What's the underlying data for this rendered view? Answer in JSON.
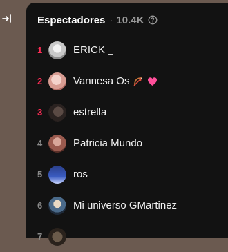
{
  "panel": {
    "title": "Espectadores",
    "separator": "·",
    "count": "10.4K"
  },
  "viewers": [
    {
      "rank": "1",
      "name": "ERICK",
      "top": true
    },
    {
      "rank": "2",
      "name": "Vannesa Os",
      "top": true
    },
    {
      "rank": "3",
      "name": "estrella",
      "top": true
    },
    {
      "rank": "4",
      "name": "Patricia Mundo",
      "top": false
    },
    {
      "rank": "5",
      "name": "ros",
      "top": false
    },
    {
      "rank": "6",
      "name": "Mi universo GMartinez",
      "top": false
    },
    {
      "rank": "7",
      "name": "",
      "top": false
    }
  ],
  "colors": {
    "top_rank": "#fe2c55",
    "panel_bg": "#121212",
    "page_bg": "#6b5a50"
  },
  "icons": {
    "collapse": "arrow-right-to-line-icon",
    "help": "question-circle-icon",
    "bow": "bow-and-arrow-emoji",
    "heart": "pink-heart-emoji"
  }
}
